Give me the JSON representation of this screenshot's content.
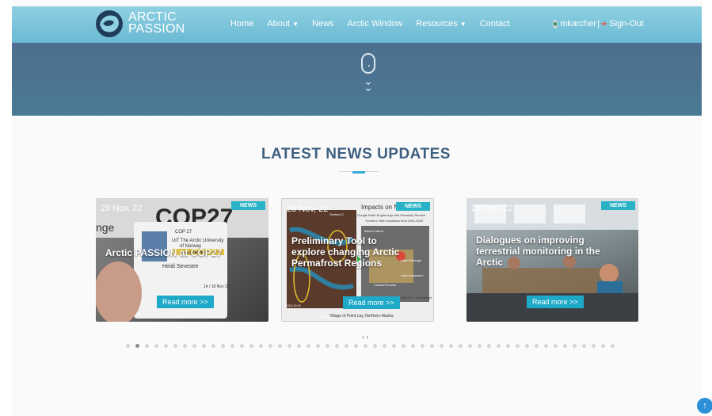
{
  "header": {
    "brand_line1": "ARCTIC",
    "brand_line2": "PASSION",
    "nav": [
      {
        "label": "Home",
        "dropdown": false
      },
      {
        "label": "About",
        "dropdown": true
      },
      {
        "label": "News",
        "dropdown": false
      },
      {
        "label": "Arctic Window",
        "dropdown": false
      },
      {
        "label": "Resources",
        "dropdown": true
      },
      {
        "label": "Contact",
        "dropdown": false
      }
    ],
    "user": "mkarcher",
    "separator": "|",
    "signout": "Sign-Out"
  },
  "section": {
    "title": "LATEST NEWS UPDATES"
  },
  "cards": [
    {
      "date": "29 Nov, 22",
      "badge": "NEWS",
      "title": "Arctic PASSION at COP27",
      "button": "Read more >>",
      "image_text": {
        "big": "COP27",
        "side": "nge",
        "pass1": "COP 27",
        "pass2": "UiT The Arctic University",
        "pass3": "of Norway",
        "pass4": "OBSERVER",
        "pass5": "Heidi Sevestre",
        "pass6": "14 / 18 Nov 22"
      }
    },
    {
      "date": "28 Nov, 22",
      "badge": "NEWS",
      "title": "Preliminary Tool to explore changing Arctic Permafrost Regions",
      "button": "Read more >>",
      "image_text": {
        "top": "Impacts on Northe",
        "sub1": "Google Earth Engine App with Remotely Sensed",
        "sub2": "Trends in 30m resolution from 2001-2020",
        "lbl1": "Sentinel 2",
        "lbl2": "Barrier Island",
        "lbl3": "Lake Drainage",
        "lbl4": "Lake Expansion",
        "lbl5": "Coastal Erosion",
        "lbl6": "ual + ESA CCI+ Permafrost",
        "lbl7": "2016.10.01",
        "lbl8": "Sentinel",
        "caption": "Village of Point Lay, Northern Alaska"
      }
    },
    {
      "date": "28 Nov, 22",
      "badge": "NEWS",
      "title": "Dialogues on improving terrestrial monitoring in the Arctic",
      "button": "Read more >>"
    }
  ],
  "carousel": {
    "prev": "‹",
    "next": "›",
    "dot_count": 52,
    "active_index": 1
  },
  "colors": {
    "header": "#79c4da",
    "hero": "#4c7290",
    "title": "#3e5f80",
    "accent": "#35a9d4",
    "badge": "#2ab3c6"
  },
  "icons": {
    "scroll": "mouse-scroll-icon",
    "user": "user-circle-icon",
    "signout": "sign-out-icon",
    "top": "arrow-up-icon"
  }
}
